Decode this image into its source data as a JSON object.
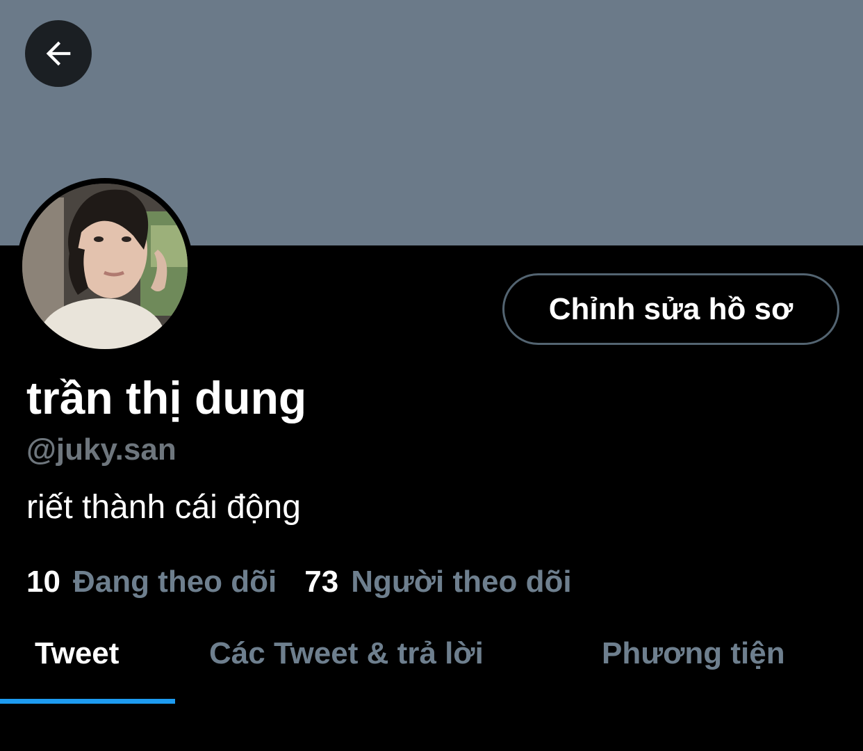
{
  "profile": {
    "display_name": "trần thị dung",
    "handle": "@juky.san",
    "bio": "riết thành cái động",
    "edit_button_label": "Chỉnh sửa hồ sơ"
  },
  "stats": {
    "following_count": "10",
    "following_label": "Đang theo dõi",
    "followers_count": "73",
    "followers_label": "Người theo dõi"
  },
  "tabs": [
    {
      "label": "Tweet",
      "active": true
    },
    {
      "label": "Các Tweet & trả lời",
      "active": false
    },
    {
      "label": "Phương tiện",
      "active": false
    }
  ],
  "icons": {
    "back": "arrow-left-icon"
  },
  "colors": {
    "banner": "#6b7a89",
    "background": "#000000",
    "secondary_text": "#6e7f8e",
    "accent": "#1d9bf0"
  }
}
